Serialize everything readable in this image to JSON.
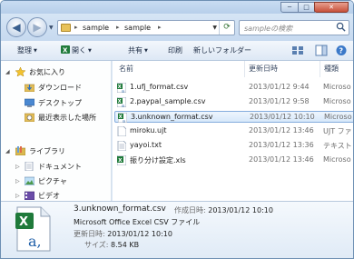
{
  "window": {
    "minimize": "─",
    "maximize": "□",
    "close": "✕"
  },
  "address": {
    "crumbs": [
      "sample",
      "sample"
    ],
    "separator": "▸"
  },
  "search": {
    "placeholder": "sampleの検索"
  },
  "toolbar": {
    "organize": "整理",
    "open": "開く",
    "share": "共有",
    "print": "印刷",
    "new_folder": "新しいフォルダー"
  },
  "nav": {
    "favorites": "お気に入り",
    "favorites_items": [
      "ダウンロード",
      "デスクトップ",
      "最近表示した場所"
    ],
    "libraries": "ライブラリ",
    "libraries_items": [
      "ドキュメント",
      "ピクチャ",
      "ビデオ"
    ]
  },
  "columns": {
    "name": "名前",
    "date": "更新日時",
    "type": "種類"
  },
  "files": [
    {
      "name": "1.ufj_format.csv",
      "date": "2013/01/12 9:44",
      "type": "Microso",
      "icon": "excel-csv-icon",
      "selected": false
    },
    {
      "name": "2.paypal_sample.csv",
      "date": "2013/01/12 9:58",
      "type": "Microso",
      "icon": "excel-csv-icon",
      "selected": false
    },
    {
      "name": "3.unknown_format.csv",
      "date": "2013/01/12 10:10",
      "type": "Microso",
      "icon": "excel-csv-icon",
      "selected": true
    },
    {
      "name": "miroku.ujt",
      "date": "2013/01/12 13:46",
      "type": "UJT ファ",
      "icon": "blank-file-icon",
      "selected": false
    },
    {
      "name": "yayoi.txt",
      "date": "2013/01/12 13:36",
      "type": "テキスト",
      "icon": "text-file-icon",
      "selected": false
    },
    {
      "name": "振り分け設定.xls",
      "date": "2013/01/12 13:46",
      "type": "Microso",
      "icon": "excel-file-icon",
      "selected": false
    }
  ],
  "details": {
    "name": "3.unknown_format.csv",
    "type": "Microsoft Office Excel CSV ファイル",
    "created_label": "作成日時:",
    "created": "2013/01/12 10:10",
    "modified_label": "更新日時:",
    "modified": "2013/01/12 10:10",
    "size_label": "サイズ:",
    "size": "8.54 KB"
  },
  "colors": {
    "selection_border": "#84acdd",
    "excel_green": "#1f7a3a",
    "title_bar": "#c9dcf2"
  }
}
